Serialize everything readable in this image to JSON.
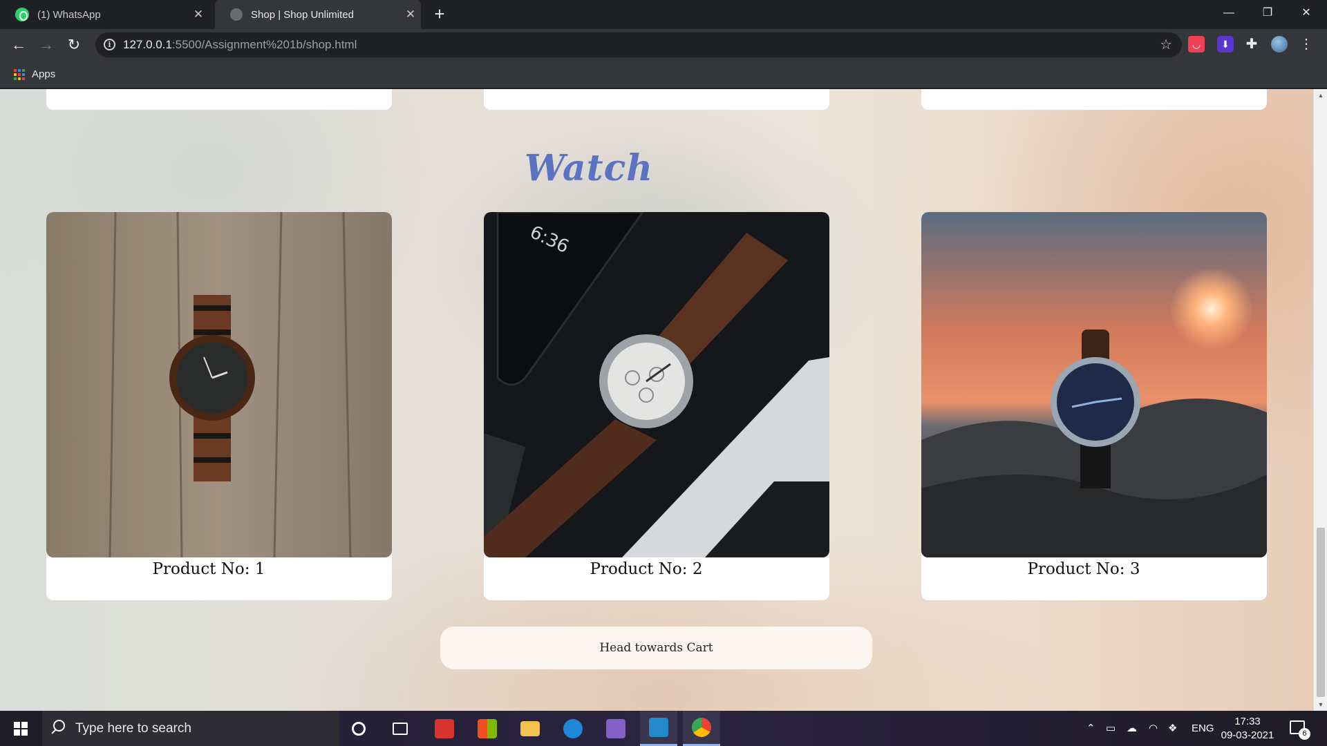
{
  "browser": {
    "tabs": [
      {
        "title": "(1) WhatsApp",
        "active": false
      },
      {
        "title": "Shop | Shop Unlimited",
        "active": true
      }
    ],
    "new_tab_label": "+",
    "url_host": "127.0.0.1",
    "url_rest": ":5500/Assignment%201b/shop.html",
    "bookmarks": {
      "apps_label": "Apps"
    }
  },
  "page": {
    "section_title": "Watch",
    "products": [
      {
        "caption": "Product No: 1"
      },
      {
        "caption": "Product No: 2"
      },
      {
        "caption": "Product No: 3"
      }
    ],
    "cart_button": "Head towards Cart",
    "title_color": "#5b73c0"
  },
  "taskbar": {
    "search_placeholder": "Type here to search",
    "language": "ENG",
    "time": "17:33",
    "date": "09-03-2021",
    "notification_count": "6",
    "pinned": [
      "cortana-icon",
      "task-view-icon",
      "gift-icon",
      "store-icon",
      "file-explorer-icon",
      "edge-icon",
      "visual-studio-icon",
      "vscode-icon",
      "chrome-icon"
    ]
  }
}
